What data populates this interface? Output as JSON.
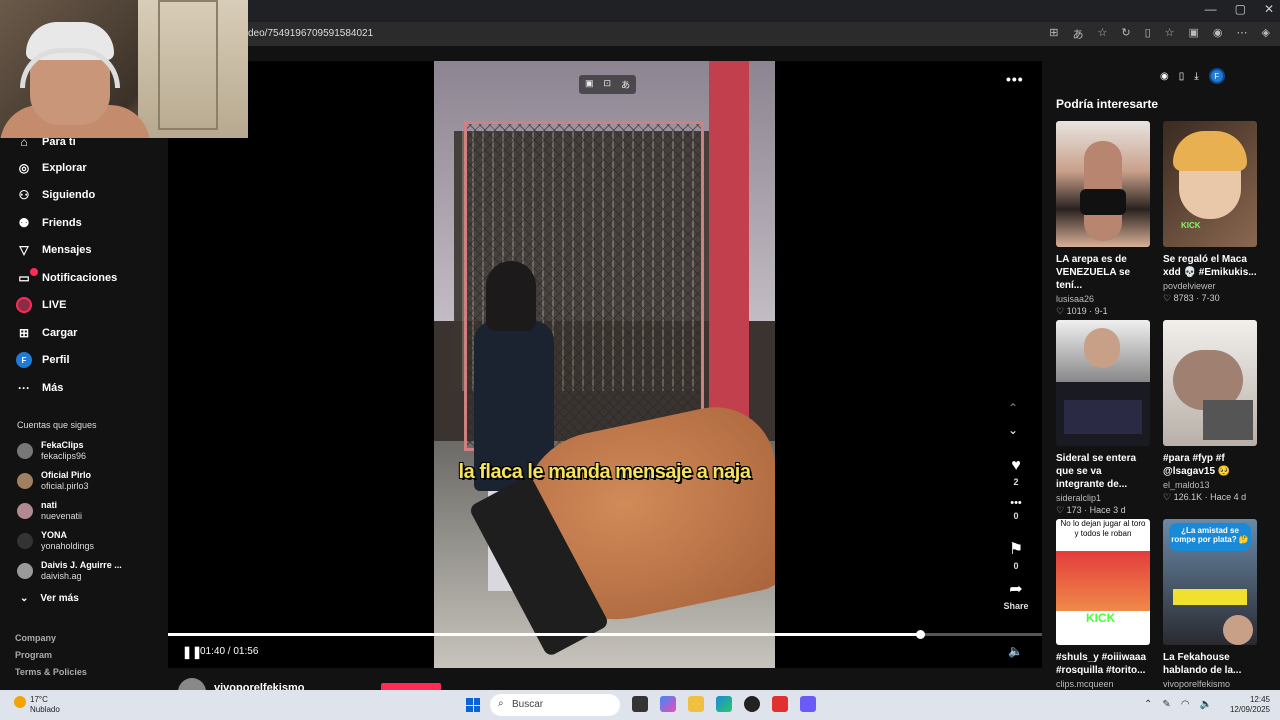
{
  "browser": {
    "url": "deo/7549196709591584021",
    "window_controls": [
      "—",
      "▢",
      "✕"
    ]
  },
  "sidebar": {
    "items": [
      {
        "label": "Para ti",
        "icon": "home-icon"
      },
      {
        "label": "Explorar",
        "icon": "compass-icon"
      },
      {
        "label": "Siguiendo",
        "icon": "user-follow-icon"
      },
      {
        "label": "Friends",
        "icon": "friends-icon"
      },
      {
        "label": "Mensajes",
        "icon": "send-icon"
      },
      {
        "label": "Notificaciones",
        "icon": "inbox-icon"
      },
      {
        "label": "LIVE",
        "icon": "live-icon"
      },
      {
        "label": "Cargar",
        "icon": "upload-icon"
      },
      {
        "label": "Perfil",
        "icon": "profile-icon",
        "avatar_letter": "F"
      },
      {
        "label": "Más",
        "icon": "more-icon"
      }
    ],
    "following_title": "Cuentas que sigues",
    "following": [
      {
        "name": "FekaClips",
        "handle": "fekaclips96"
      },
      {
        "name": "Oficial Pirlo",
        "handle": "oficial.pirlo3"
      },
      {
        "name": "nati",
        "handle": "nuevenatii"
      },
      {
        "name": "YONA",
        "handle": "yonaholdings"
      },
      {
        "name": "Daivis J. Aguirre ...",
        "handle": "daivish.ag"
      }
    ],
    "see_more": "Ver más",
    "footer": [
      "Company",
      "Program",
      "Terms & Policies"
    ]
  },
  "video": {
    "caption": "la flaca le manda mensaje a naja",
    "current_time": "01:40",
    "duration": "01:56",
    "time_separator": " / ",
    "progress": 0.86,
    "more": "•••",
    "author": "vivoporelfekismo",
    "actions": [
      {
        "name": "like",
        "icon": "♥",
        "count": "2"
      },
      {
        "name": "comment",
        "icon": "•••",
        "count": "0"
      },
      {
        "name": "save",
        "icon": "⚑",
        "count": "0"
      },
      {
        "name": "share",
        "icon": "➦",
        "count": "Share"
      }
    ]
  },
  "rail": {
    "title": "Podría interesarte",
    "profile_letter": "F",
    "cards": [
      {
        "title": "LA arepa es de VENEZUELA se tení...",
        "author": "lusisaa26",
        "meta": "♡ 1019 · 9-1",
        "colors": [
          "#c79f86",
          "#3a2a28"
        ]
      },
      {
        "title": "Se regaló el Maca xdd 💀 #Emikukis...",
        "author": "povdelviewer",
        "meta": "♡ 8783 · 7-30",
        "colors": [
          "#c7a278",
          "#4a3528"
        ]
      },
      {
        "title": "Sideral se entera que se va integrante de...",
        "author": "sideralclip1",
        "meta": "♡ 173 · Hace 3 d",
        "colors": [
          "#8a8a90",
          "#1a1a22"
        ]
      },
      {
        "title": "#para #fyp #f @lsagav15 🥺",
        "author": "el_maldo13",
        "meta": "♡ 126.1K · Hace 4 d",
        "colors": [
          "#d9d6d2",
          "#6a5a52"
        ]
      },
      {
        "title": "#shuls_y #oiiiwaaa #rosquilla #torito...",
        "author": "clips.mcqueen",
        "meta": "",
        "colors": [
          "#e33c3c",
          "#2a8a3a"
        ]
      },
      {
        "title": "La Fekahouse hablando de la...",
        "author": "vivoporelfekismo",
        "meta": "",
        "colors": [
          "#8aa8c8",
          "#2a2a30"
        ]
      }
    ],
    "card3_overlay": "No lo dejan jugar al toro y todos le roban",
    "card3_badge": "KICK",
    "card5_overlay": "¿La amistad se rompe por plata? 🤔"
  },
  "taskbar": {
    "temperature": "17°C",
    "weather": "Nublado",
    "search_placeholder": "Buscar",
    "time": "12:45",
    "date": "12/09/2025"
  },
  "colors": {
    "accent": "#fe2c55",
    "profile": "#1f7bd6"
  }
}
